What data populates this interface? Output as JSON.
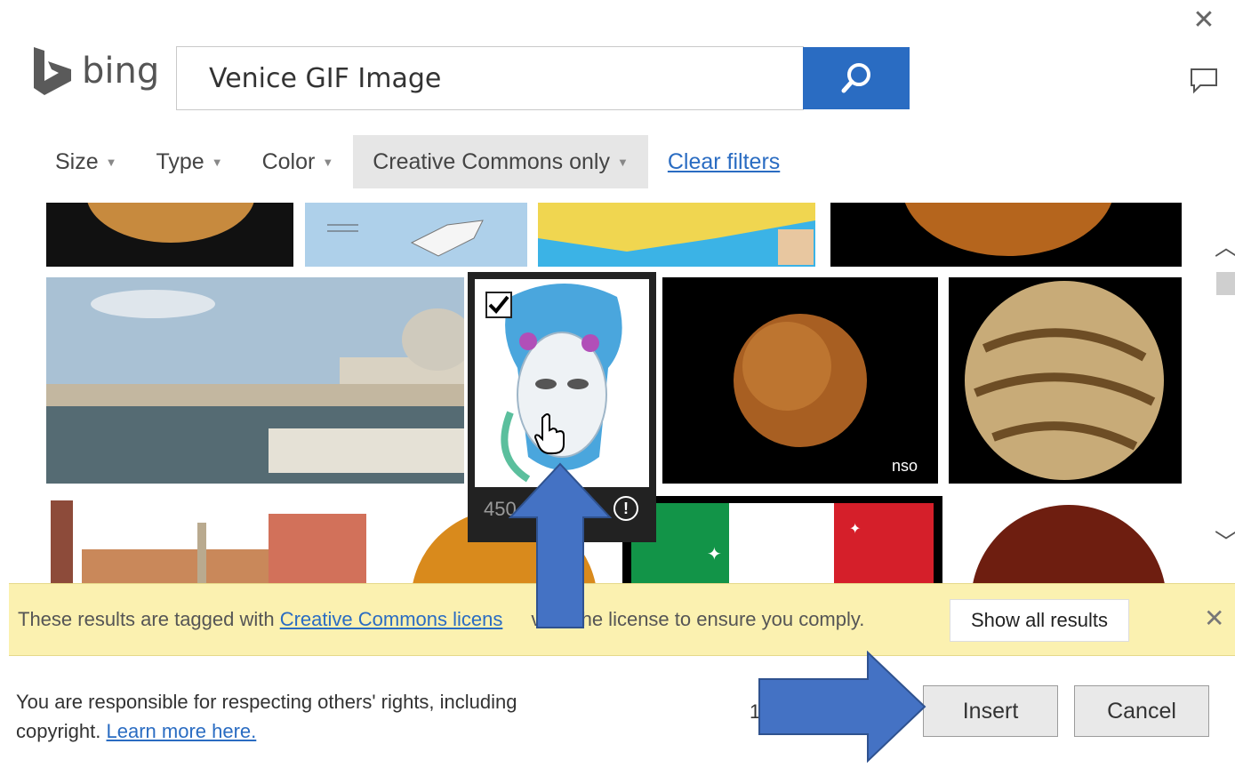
{
  "header": {
    "logo_text": "bing",
    "close_glyph": "✕",
    "search_value": "Venice GIF Image"
  },
  "filters": {
    "size": "Size",
    "type": "Type",
    "color": "Color",
    "license": "Creative Commons only",
    "clear": "Clear filters"
  },
  "selected": {
    "size_text": "450",
    "info_glyph": "!"
  },
  "notice": {
    "text_before": "These results are tagged with ",
    "link": "Creative Commons licens",
    "text_after": "view the license to ensure you comply.",
    "show_all": "Show all results",
    "close_glyph": "✕"
  },
  "footer": {
    "line1": "You are responsible for respecting others' rights, including",
    "line2": "copyright.",
    "learn_more": "Learn more here.",
    "count": "1",
    "insert": "Insert",
    "cancel": "Cancel"
  },
  "colors": {
    "accent": "#2a6cc2",
    "notice_bg": "#fbf1b0",
    "arrow": "#4472c4"
  },
  "icons": [
    "bing-logo-icon",
    "close-icon",
    "feedback-icon",
    "search-icon",
    "chevron-up-icon",
    "chevron-down-icon",
    "checkbox-icon",
    "info-icon",
    "hand-cursor-icon"
  ]
}
